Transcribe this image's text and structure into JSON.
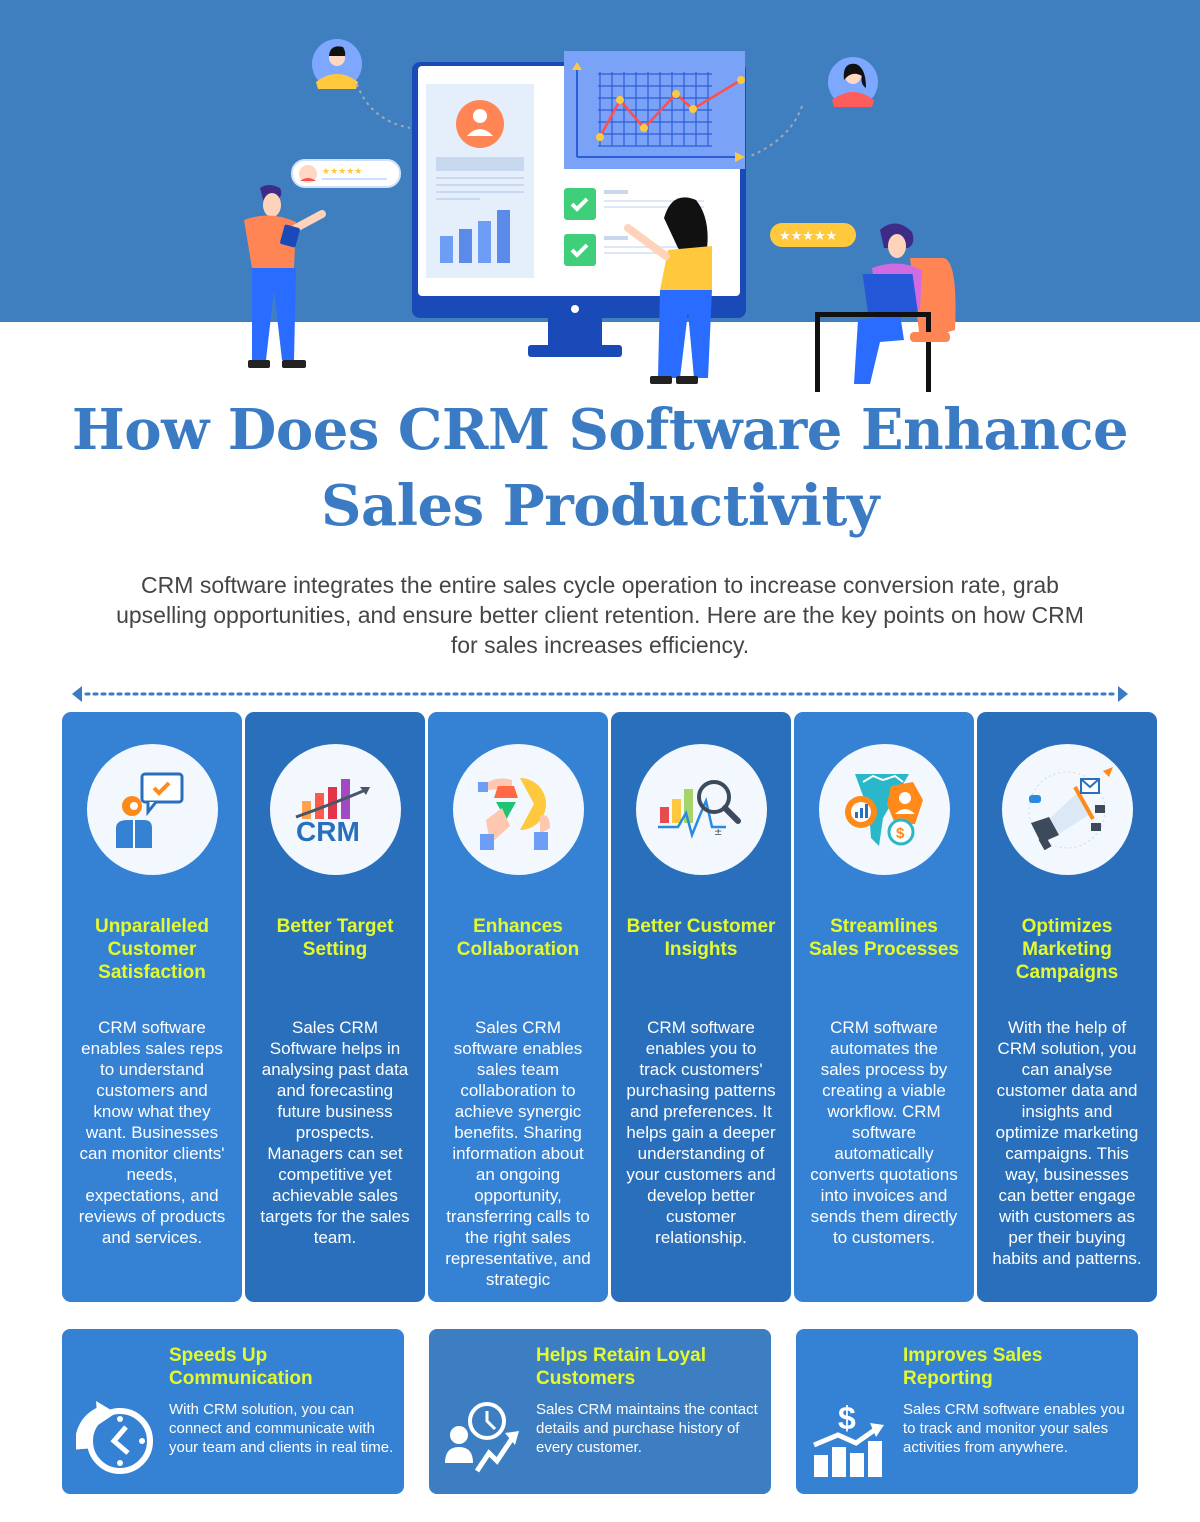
{
  "header": {
    "title_line1": "How Does CRM Software Enhance",
    "title_line2": "Sales Productivity",
    "intro": "CRM software integrates the entire sales cycle operation to increase conversion rate, grab upselling opportunities, and ensure better client retention. Here are the key points on how CRM for sales increases efficiency."
  },
  "hero": {
    "rating_stars": "★★★★★",
    "illustration": "crm-dashboard-illustration"
  },
  "colors": {
    "hero_bg": "#3f7fc0",
    "title": "#3a7bc3",
    "card_light": "#3581d3",
    "card_dark": "#2a6fbb",
    "accent_yellow": "#e4f92e"
  },
  "columns": [
    {
      "icon": "customer-satisfaction-icon",
      "title": "Unparalleled Customer Satisfaction",
      "body": "CRM software enables sales reps to understand customers and know what they want. Businesses can monitor clients' needs, expectations, and reviews of products and services."
    },
    {
      "icon": "crm-growth-chart-icon",
      "title": "Better Target Setting",
      "body": "Sales CRM Software helps in analysing past data and forecasting future business prospects. Managers can set competitive yet achievable sales targets for the sales team."
    },
    {
      "icon": "collaboration-pie-icon",
      "title": "Enhances Collaboration",
      "body": "Sales CRM software enables sales team collaboration to achieve synergic benefits. Sharing information about an ongoing opportunity, transferring calls to the right sales representative, and strategic"
    },
    {
      "icon": "insights-magnifier-icon",
      "title": "Better Customer Insights",
      "body": "CRM software enables you to track customers' purchasing patterns and preferences. It helps gain a deeper understanding of your customers and develop better customer relationship."
    },
    {
      "icon": "sales-process-funnel-icon",
      "title": "Streamlines Sales Processes",
      "body": "CRM software automates the sales process by creating a viable workflow. CRM software automatically converts quotations into invoices and sends them directly to customers."
    },
    {
      "icon": "marketing-megaphone-icon",
      "title": "Optimizes Marketing Campaigns",
      "body": "With the help of CRM solution, you can analyse customer data and insights and optimize marketing campaigns. This way, businesses can better engage with customers as per their buying habits and patterns."
    }
  ],
  "bottom_cards": [
    {
      "icon": "clock-refresh-icon",
      "title": "Speeds Up Communication",
      "body": "With CRM solution, you can connect and communicate with your team and clients in real time."
    },
    {
      "icon": "loyal-customer-growth-icon",
      "title": "Helps Retain Loyal Customers",
      "body": "Sales CRM maintains the contact details and purchase history of every customer."
    },
    {
      "icon": "dollar-bar-chart-icon",
      "title": "Improves Sales Reporting",
      "body": "Sales CRM software enables you to track and monitor your sales activities from anywhere."
    }
  ]
}
